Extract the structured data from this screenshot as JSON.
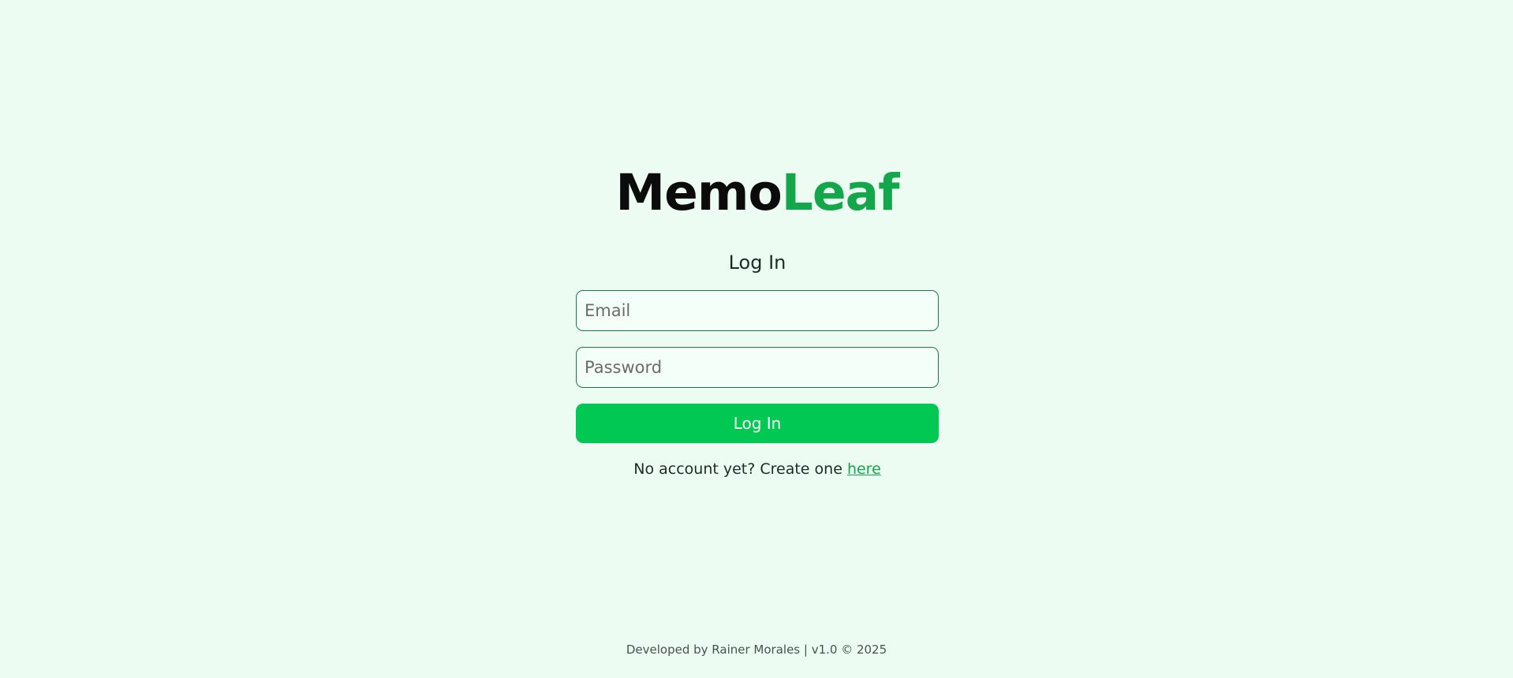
{
  "brand": {
    "name_part1": "Memo",
    "name_part2": "Leaf",
    "colors": {
      "dark": "#0b0b0b",
      "accent": "#13a64a",
      "button": "#00c853",
      "background": "#ecfcf2",
      "field_border": "#1b7a47"
    }
  },
  "login_form": {
    "title": "Log In",
    "email_placeholder": "Email",
    "email_value": "",
    "password_placeholder": "Password",
    "password_value": "",
    "submit_label": "Log In"
  },
  "signup": {
    "prompt": "No account yet? Create one",
    "link_text": "here"
  },
  "footer": {
    "text": "Developed by Rainer Morales | v1.0 © 2025"
  }
}
